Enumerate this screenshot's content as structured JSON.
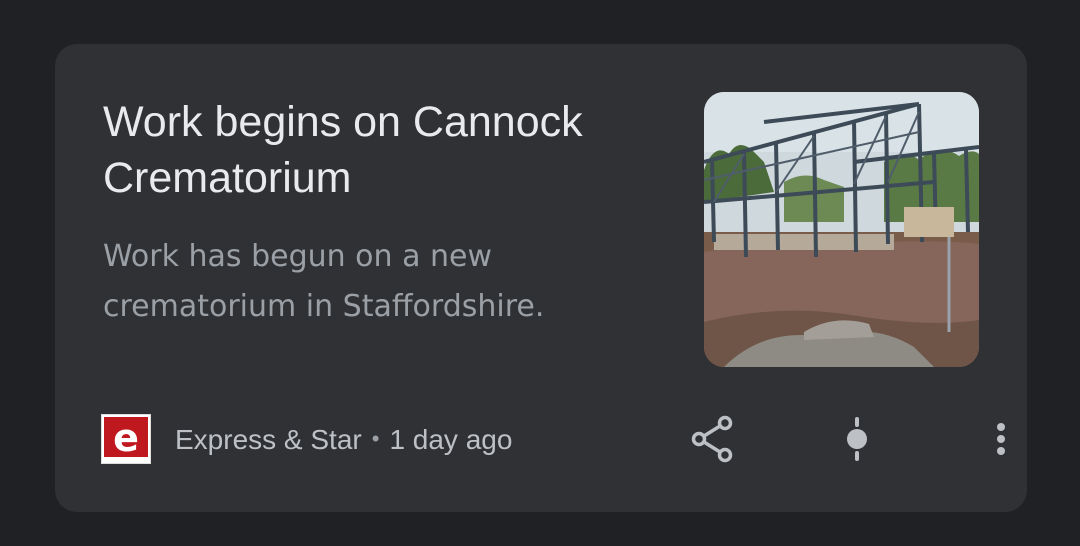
{
  "article": {
    "title": "Work begins on Cannock Crematorium",
    "snippet": "Work has begun on a new crematorium in Staffordshire.",
    "thumbnail_icon": "construction-photo"
  },
  "source": {
    "name": "Express & Star",
    "separator": "•",
    "time": "1 day ago",
    "logo_letter": "e",
    "logo_color": "#c0181f"
  },
  "actions": {
    "share_icon": "share-icon",
    "perspective_icon": "full-coverage-icon",
    "more_icon": "more-vert-icon"
  },
  "colors": {
    "background": "#202124",
    "card": "#303134",
    "title": "#e8eaed",
    "snippet": "#9aa0a6",
    "icon": "#bdc1c6"
  }
}
